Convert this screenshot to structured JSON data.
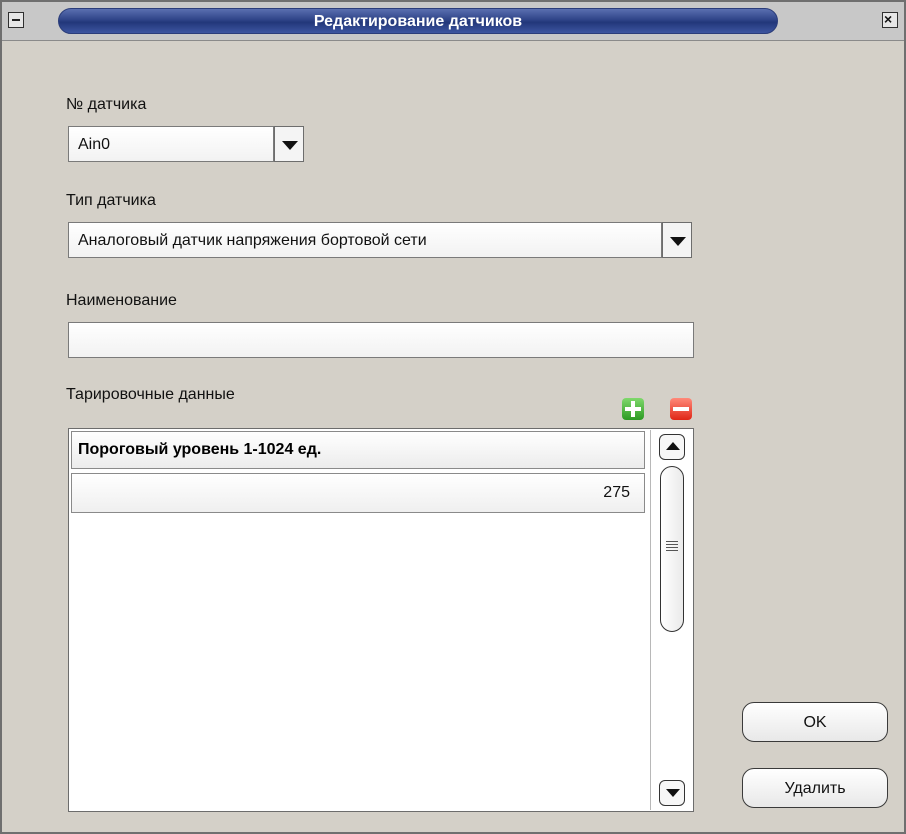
{
  "window": {
    "title": "Редактирование датчиков"
  },
  "sensor_number": {
    "label": "№ датчика",
    "value": "Ain0"
  },
  "sensor_type": {
    "label": "Тип датчика",
    "value": "Аналоговый датчик напряжения бортовой сети"
  },
  "name": {
    "label": "Наименование",
    "value": ""
  },
  "calibration": {
    "label": "Тарировочные данные",
    "columns": [
      "Пороговый уровень 1-1024 ед."
    ],
    "rows": [
      [
        "275"
      ]
    ]
  },
  "buttons": {
    "ok": "OK",
    "delete": "Удалить"
  },
  "icons": {
    "add": "plus-icon",
    "remove": "minus-icon",
    "minimize": "minimize-icon",
    "close": "close-icon"
  }
}
